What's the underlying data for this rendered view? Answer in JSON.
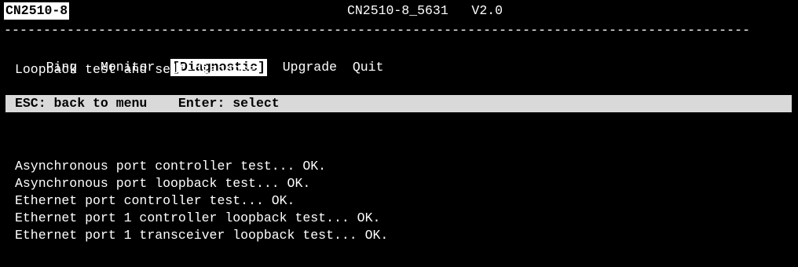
{
  "title_bar": {
    "model": "CN2510-8",
    "device_info": "CN2510-8_5631   V2.0"
  },
  "divider": "-----------------------------------------------------------------------------------------------",
  "menu": {
    "items": [
      {
        "label": "Ping",
        "selected": false
      },
      {
        "label": "Monitor",
        "selected": false
      },
      {
        "label": "[Diagnostic]",
        "selected": true
      },
      {
        "label": "Upgrade",
        "selected": false
      },
      {
        "label": "Quit",
        "selected": false
      }
    ],
    "description": "Loopback test and self-diagnose"
  },
  "help": {
    "text": "ESC: back to menu    Enter: select"
  },
  "results": [
    "Asynchronous port controller test... OK.",
    "Asynchronous port loopback test... OK.",
    "Ethernet port controller test... OK.",
    "Ethernet port 1 controller loopback test... OK.",
    "Ethernet port 1 transceiver loopback test... OK."
  ]
}
